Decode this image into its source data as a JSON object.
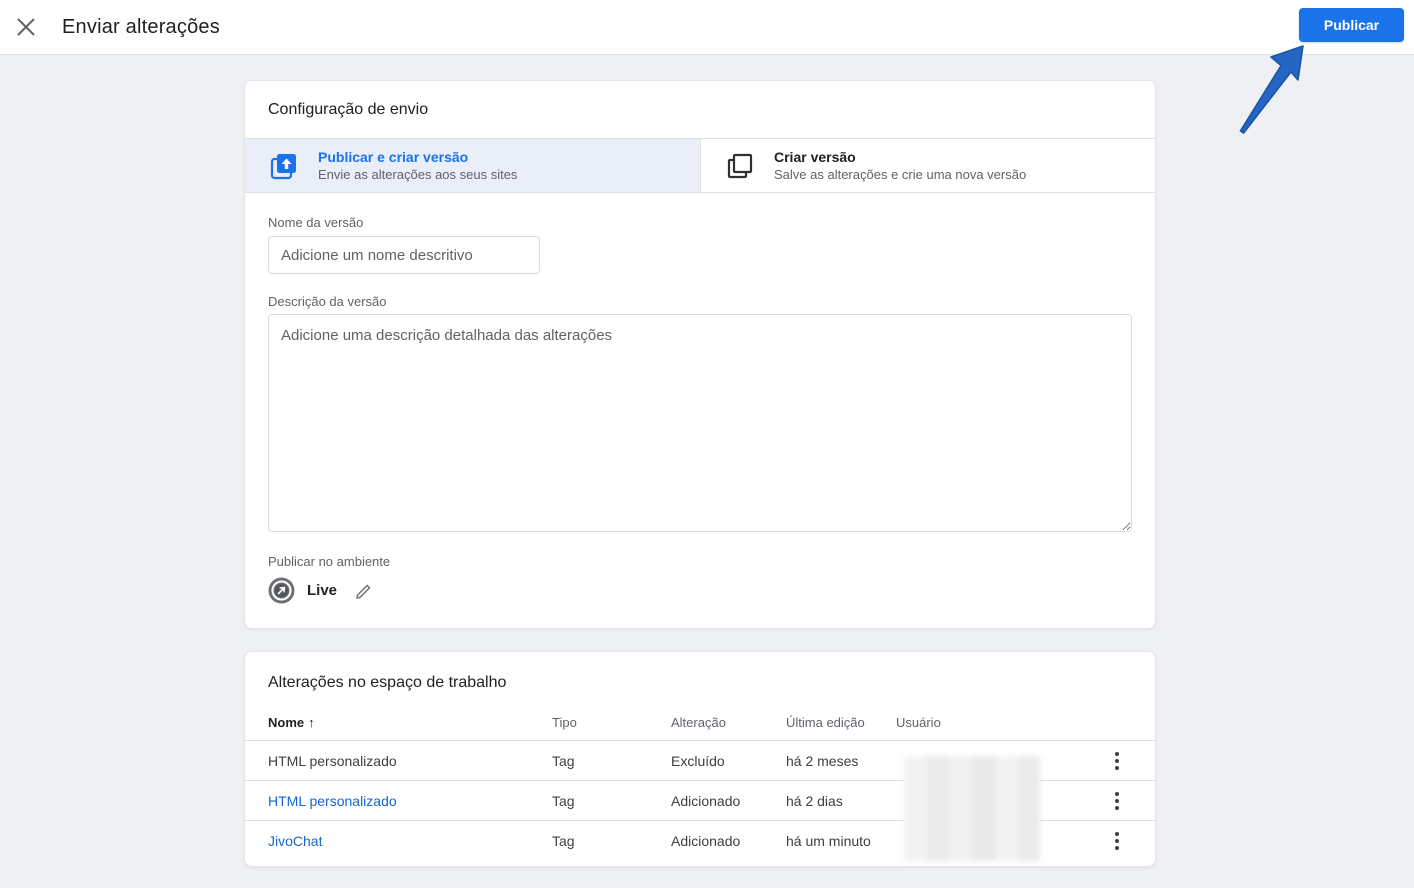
{
  "header": {
    "title": "Enviar alterações",
    "publish_button": "Publicar"
  },
  "submission_card": {
    "title": "Configuração de envio",
    "tabs": [
      {
        "title": "Publicar e criar versão",
        "subtitle": "Envie as alterações aos seus sites",
        "selected": true
      },
      {
        "title": "Criar versão",
        "subtitle": "Salve as alterações e crie uma nova versão",
        "selected": false
      }
    ],
    "version_name": {
      "label": "Nome da versão",
      "placeholder": "Adicione um nome descritivo",
      "value": ""
    },
    "version_description": {
      "label": "Descrição da versão",
      "placeholder": "Adicione uma descrição detalhada das alterações",
      "value": ""
    },
    "environment": {
      "label": "Publicar no ambiente",
      "value": "Live"
    }
  },
  "changes_card": {
    "title": "Alterações no espaço de trabalho",
    "columns": [
      "Nome",
      "Tipo",
      "Alteração",
      "Última edição",
      "Usuário"
    ],
    "sort_column": "Nome",
    "sort_direction": "asc",
    "rows": [
      {
        "name": "HTML personalizado",
        "name_link": false,
        "type": "Tag",
        "change": "Excluído",
        "last_edit": "há 2 meses"
      },
      {
        "name": "HTML personalizado",
        "name_link": true,
        "type": "Tag",
        "change": "Adicionado",
        "last_edit": "há 2 dias"
      },
      {
        "name": "JivoChat",
        "name_link": true,
        "type": "Tag",
        "change": "Adicionado",
        "last_edit": "há um minuto"
      }
    ]
  },
  "colors": {
    "accent_blue": "#1a73e8",
    "link_blue": "#1765cc",
    "selected_tab_bg": "#e9eef9",
    "annotation_arrow": "#2566c5",
    "page_bg": "#eef0f3"
  }
}
